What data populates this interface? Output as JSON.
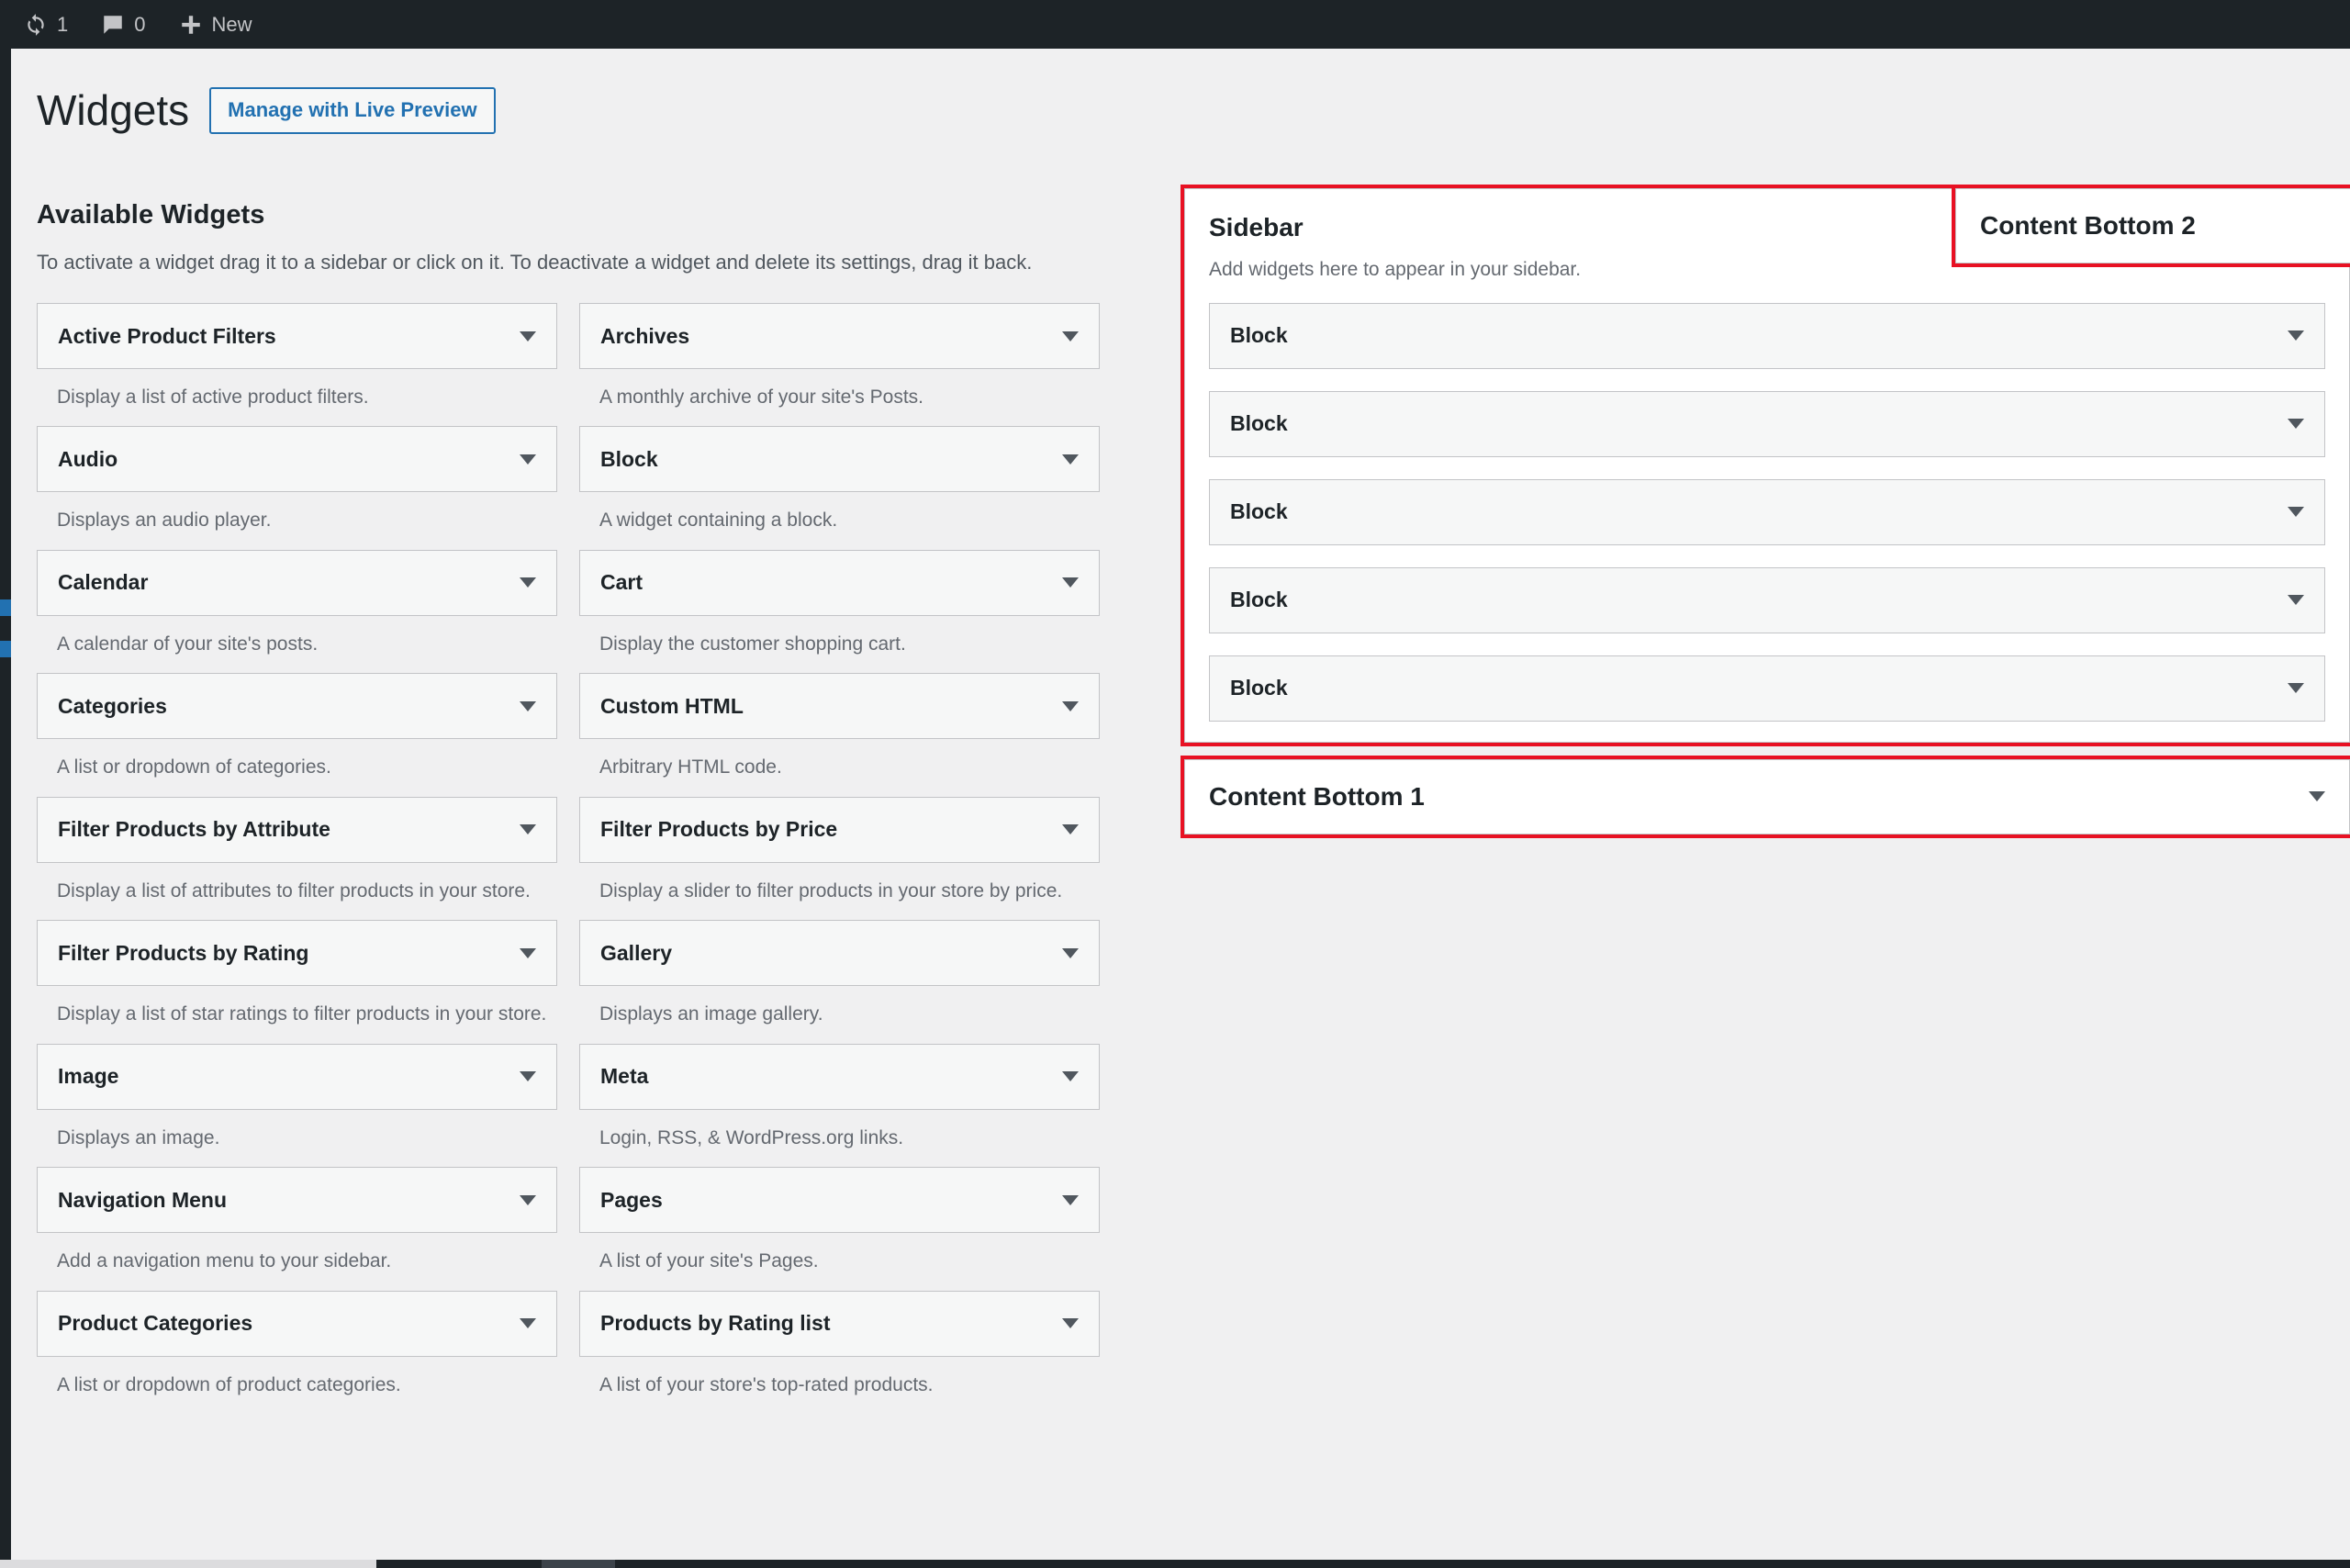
{
  "adminbar": {
    "update_icon": "update-icon",
    "update_count": "1",
    "comment_icon": "comment-icon",
    "comment_count": "0",
    "plus_icon": "plus-icon",
    "new_label": "New"
  },
  "header": {
    "title": "Widgets",
    "live_preview_label": "Manage with Live Preview"
  },
  "available": {
    "title": "Available Widgets",
    "description": "To activate a widget drag it to a sidebar or click on it. To deactivate a widget and delete its settings, drag it back.",
    "column_left": [
      {
        "name": "Active Product Filters",
        "desc": "Display a list of active product filters."
      },
      {
        "name": "Audio",
        "desc": "Displays an audio player."
      },
      {
        "name": "Calendar",
        "desc": "A calendar of your site's posts."
      },
      {
        "name": "Categories",
        "desc": "A list or dropdown of categories."
      },
      {
        "name": "Filter Products by Attribute",
        "desc": "Display a list of attributes to filter products in your store."
      },
      {
        "name": "Filter Products by Rating",
        "desc": "Display a list of star ratings to filter products in your store."
      },
      {
        "name": "Image",
        "desc": "Displays an image."
      },
      {
        "name": "Navigation Menu",
        "desc": "Add a navigation menu to your sidebar."
      },
      {
        "name": "Product Categories",
        "desc": "A list or dropdown of product categories."
      }
    ],
    "column_right": [
      {
        "name": "Archives",
        "desc": "A monthly archive of your site's Posts."
      },
      {
        "name": "Block",
        "desc": "A widget containing a block."
      },
      {
        "name": "Cart",
        "desc": "Display the customer shopping cart."
      },
      {
        "name": "Custom HTML",
        "desc": "Arbitrary HTML code."
      },
      {
        "name": "Filter Products by Price",
        "desc": "Display a slider to filter products in your store by price."
      },
      {
        "name": "Gallery",
        "desc": "Displays an image gallery."
      },
      {
        "name": "Meta",
        "desc": "Login, RSS, & WordPress.org links."
      },
      {
        "name": "Pages",
        "desc": "A list of your site's Pages."
      },
      {
        "name": "Products by Rating list",
        "desc": "A list of your store's top-rated products."
      }
    ]
  },
  "sidebar_panel": {
    "name": "Sidebar",
    "description": "Add widgets here to appear in your sidebar.",
    "toggle_icon": "chevron-up-icon",
    "widgets": [
      {
        "name": "Block"
      },
      {
        "name": "Block"
      },
      {
        "name": "Block"
      },
      {
        "name": "Block"
      },
      {
        "name": "Block"
      }
    ]
  },
  "content_bottom_1": {
    "name": "Content Bottom 1",
    "toggle_icon": "chevron-down-icon"
  },
  "content_bottom_2": {
    "name": "Content Bottom 2"
  },
  "colors": {
    "highlight": "#e81123",
    "accent": "#2271b1",
    "adminbar_bg": "#1d2327",
    "page_bg": "#f0f0f1",
    "card_bg": "#f6f7f7",
    "border": "#c3c4c7"
  }
}
